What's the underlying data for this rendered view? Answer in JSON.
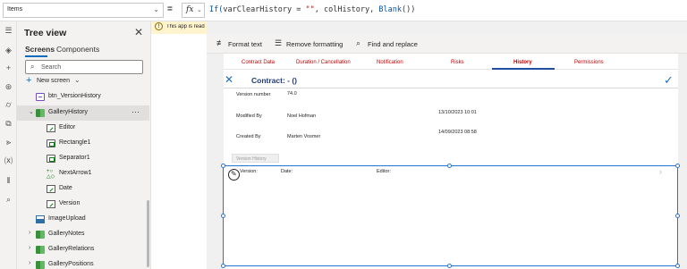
{
  "formula_bar": {
    "property": "Items",
    "equals": "=",
    "fx": "fx",
    "formula_parts": [
      {
        "text": "If(",
        "kind": "fn"
      },
      {
        "text": "varClearHistory = ",
        "kind": "plain"
      },
      {
        "text": "\"\"",
        "kind": "str"
      },
      {
        "text": ", colHistory, ",
        "kind": "plain"
      },
      {
        "text": "Blank",
        "kind": "fn"
      },
      {
        "text": "())",
        "kind": "plain"
      }
    ]
  },
  "tree_view": {
    "title": "Tree view",
    "tabs": [
      "Screens",
      "Components"
    ],
    "search_placeholder": "Search",
    "new_screen_label": "New screen",
    "more_label": "···",
    "nodes": [
      {
        "label": "btn_VersionHistory",
        "icon": "button-icon"
      },
      {
        "label": "GalleryHistory",
        "icon": "gallery-icon"
      },
      {
        "label": "Editor",
        "icon": "edit-icon"
      },
      {
        "label": "Rectangle1",
        "icon": "rectangle-icon"
      },
      {
        "label": "Separator1",
        "icon": "separator-icon"
      },
      {
        "label": "NextArrow1",
        "icon": "next-arrow-icon"
      },
      {
        "label": "Date",
        "icon": "edit-icon"
      },
      {
        "label": "Version",
        "icon": "edit-icon"
      },
      {
        "label": "ImageUpload",
        "icon": "image-icon"
      },
      {
        "label": "GalleryNotes",
        "icon": "gallery-icon"
      },
      {
        "label": "GalleryRelations",
        "icon": "gallery-icon"
      },
      {
        "label": "GalleryPositions",
        "icon": "gallery-icon"
      }
    ]
  },
  "warning": {
    "text": "This app is read"
  },
  "format_bar": {
    "format_text": "Format text",
    "remove_formatting": "Remove formatting",
    "find_replace": "Find and replace"
  },
  "app": {
    "tabs": [
      "Contract Data",
      "Duration / Cancellation",
      "Notification",
      "Risks",
      "History",
      "Permissions"
    ],
    "active_tab": "History",
    "header_title": "Contract:  - ()",
    "fields": [
      {
        "label": "Version number",
        "value": "74.0"
      },
      {
        "label": "Modified By",
        "value": "Noel Hofman",
        "date": "13/10/2023 10:01"
      },
      {
        "label": "Created By",
        "value": "Marten Vosmer",
        "date": "14/09/2023 08:58"
      }
    ],
    "version_history_button": "Version History",
    "gallery": {
      "version_label": "Version:",
      "date_label": "Date:",
      "editor_label": "Editor:"
    }
  },
  "colors": {
    "accent": "#0f6cbd",
    "tab_red": "#c00000",
    "selection_blue": "#2a73d6",
    "header_navy": "#1f3c78"
  }
}
